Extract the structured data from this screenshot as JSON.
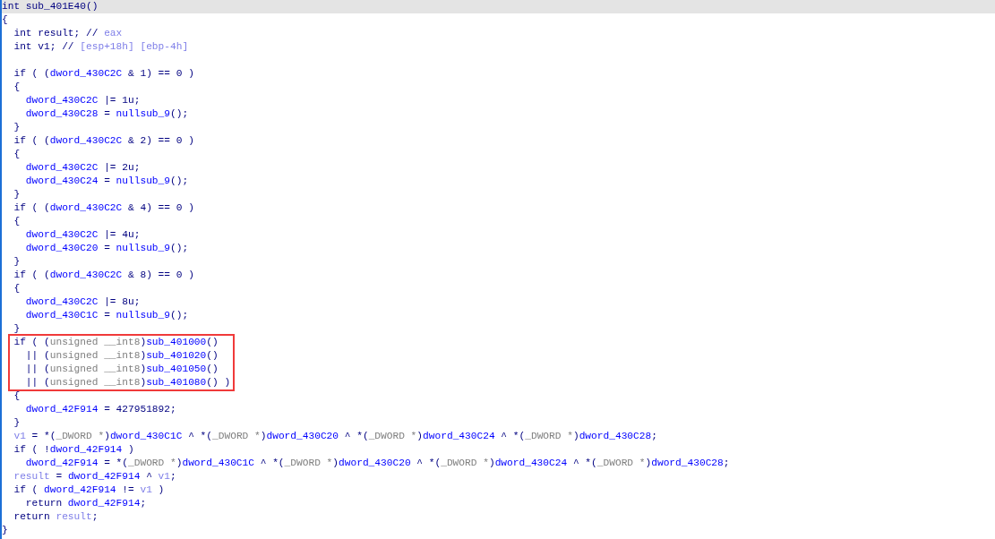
{
  "code_lines": [
    {
      "selected": true,
      "boxed": false,
      "tokens": [
        {
          "kind": "plain",
          "text": "int sub_401E40()"
        }
      ]
    },
    {
      "selected": false,
      "boxed": false,
      "tokens": [
        {
          "kind": "plain",
          "text": "{"
        }
      ]
    },
    {
      "selected": false,
      "boxed": false,
      "tokens": [
        {
          "kind": "plain",
          "text": "  int result; // "
        },
        {
          "kind": "local",
          "text": "eax"
        }
      ]
    },
    {
      "selected": false,
      "boxed": false,
      "tokens": [
        {
          "kind": "plain",
          "text": "  int v1; // "
        },
        {
          "kind": "local",
          "text": "[esp+18h] [ebp-4h]"
        }
      ]
    },
    {
      "selected": false,
      "boxed": false
    },
    {
      "selected": false,
      "boxed": false,
      "tokens": [
        {
          "kind": "plain",
          "text": "  if ( ("
        },
        {
          "kind": "global",
          "text": "dword_430C2C"
        },
        {
          "kind": "plain",
          "text": " & 1) == 0 )"
        }
      ]
    },
    {
      "selected": false,
      "boxed": false,
      "tokens": [
        {
          "kind": "plain",
          "text": "  {"
        }
      ]
    },
    {
      "selected": false,
      "boxed": false,
      "tokens": [
        {
          "kind": "global",
          "text": "    dword_430C2C"
        },
        {
          "kind": "plain",
          "text": " |= 1u;"
        }
      ]
    },
    {
      "selected": false,
      "boxed": false,
      "tokens": [
        {
          "kind": "global",
          "text": "    dword_430C28"
        },
        {
          "kind": "plain",
          "text": " = "
        },
        {
          "kind": "global",
          "text": "nullsub_9"
        },
        {
          "kind": "plain",
          "text": "();"
        }
      ]
    },
    {
      "selected": false,
      "boxed": false,
      "tokens": [
        {
          "kind": "plain",
          "text": "  }"
        }
      ]
    },
    {
      "selected": false,
      "boxed": false,
      "tokens": [
        {
          "kind": "plain",
          "text": "  if ( ("
        },
        {
          "kind": "global",
          "text": "dword_430C2C"
        },
        {
          "kind": "plain",
          "text": " & 2) == 0 )"
        }
      ]
    },
    {
      "selected": false,
      "boxed": false,
      "tokens": [
        {
          "kind": "plain",
          "text": "  {"
        }
      ]
    },
    {
      "selected": false,
      "boxed": false,
      "tokens": [
        {
          "kind": "global",
          "text": "    dword_430C2C"
        },
        {
          "kind": "plain",
          "text": " |= 2u;"
        }
      ]
    },
    {
      "selected": false,
      "boxed": false,
      "tokens": [
        {
          "kind": "global",
          "text": "    dword_430C24"
        },
        {
          "kind": "plain",
          "text": " = "
        },
        {
          "kind": "global",
          "text": "nullsub_9"
        },
        {
          "kind": "plain",
          "text": "();"
        }
      ]
    },
    {
      "selected": false,
      "boxed": false,
      "tokens": [
        {
          "kind": "plain",
          "text": "  }"
        }
      ]
    },
    {
      "selected": false,
      "boxed": false,
      "tokens": [
        {
          "kind": "plain",
          "text": "  if ( ("
        },
        {
          "kind": "global",
          "text": "dword_430C2C"
        },
        {
          "kind": "plain",
          "text": " & 4) == 0 )"
        }
      ]
    },
    {
      "selected": false,
      "boxed": false,
      "tokens": [
        {
          "kind": "plain",
          "text": "  {"
        }
      ]
    },
    {
      "selected": false,
      "boxed": false,
      "tokens": [
        {
          "kind": "global",
          "text": "    dword_430C2C"
        },
        {
          "kind": "plain",
          "text": " |= 4u;"
        }
      ]
    },
    {
      "selected": false,
      "boxed": false,
      "tokens": [
        {
          "kind": "global",
          "text": "    dword_430C20"
        },
        {
          "kind": "plain",
          "text": " = "
        },
        {
          "kind": "global",
          "text": "nullsub_9"
        },
        {
          "kind": "plain",
          "text": "();"
        }
      ]
    },
    {
      "selected": false,
      "boxed": false,
      "tokens": [
        {
          "kind": "plain",
          "text": "  }"
        }
      ]
    },
    {
      "selected": false,
      "boxed": false,
      "tokens": [
        {
          "kind": "plain",
          "text": "  if ( ("
        },
        {
          "kind": "global",
          "text": "dword_430C2C"
        },
        {
          "kind": "plain",
          "text": " & 8) == 0 )"
        }
      ]
    },
    {
      "selected": false,
      "boxed": false,
      "tokens": [
        {
          "kind": "plain",
          "text": "  {"
        }
      ]
    },
    {
      "selected": false,
      "boxed": false,
      "tokens": [
        {
          "kind": "global",
          "text": "    dword_430C2C"
        },
        {
          "kind": "plain",
          "text": " |= 8u;"
        }
      ]
    },
    {
      "selected": false,
      "boxed": false,
      "tokens": [
        {
          "kind": "global",
          "text": "    dword_430C1C"
        },
        {
          "kind": "plain",
          "text": " = "
        },
        {
          "kind": "global",
          "text": "nullsub_9"
        },
        {
          "kind": "plain",
          "text": "();"
        }
      ]
    },
    {
      "selected": false,
      "boxed": false,
      "tokens": [
        {
          "kind": "plain",
          "text": "  }"
        }
      ]
    },
    {
      "selected": false,
      "boxed": true,
      "tokens": [
        {
          "kind": "plain",
          "text": "  if ( ("
        },
        {
          "kind": "cast",
          "text": "unsigned __int8"
        },
        {
          "kind": "plain",
          "text": ")"
        },
        {
          "kind": "global",
          "text": "sub_401000"
        },
        {
          "kind": "plain",
          "text": "()"
        }
      ]
    },
    {
      "selected": false,
      "boxed": true,
      "tokens": [
        {
          "kind": "plain",
          "text": "    || ("
        },
        {
          "kind": "cast",
          "text": "unsigned __int8"
        },
        {
          "kind": "plain",
          "text": ")"
        },
        {
          "kind": "global",
          "text": "sub_401020"
        },
        {
          "kind": "plain",
          "text": "()"
        }
      ]
    },
    {
      "selected": false,
      "boxed": true,
      "tokens": [
        {
          "kind": "plain",
          "text": "    || ("
        },
        {
          "kind": "cast",
          "text": "unsigned __int8"
        },
        {
          "kind": "plain",
          "text": ")"
        },
        {
          "kind": "global",
          "text": "sub_401050"
        },
        {
          "kind": "plain",
          "text": "()"
        }
      ]
    },
    {
      "selected": false,
      "boxed": true,
      "tokens": [
        {
          "kind": "plain",
          "text": "    || ("
        },
        {
          "kind": "cast",
          "text": "unsigned __int8"
        },
        {
          "kind": "plain",
          "text": ")"
        },
        {
          "kind": "global",
          "text": "sub_401080"
        },
        {
          "kind": "plain",
          "text": "() )"
        }
      ]
    },
    {
      "selected": false,
      "boxed": false,
      "tokens": [
        {
          "kind": "plain",
          "text": "  {"
        }
      ]
    },
    {
      "selected": false,
      "boxed": false,
      "tokens": [
        {
          "kind": "global",
          "text": "    dword_42F914"
        },
        {
          "kind": "plain",
          "text": " = 427951892;"
        }
      ]
    },
    {
      "selected": false,
      "boxed": false,
      "tokens": [
        {
          "kind": "plain",
          "text": "  }"
        }
      ]
    },
    {
      "selected": false,
      "boxed": false,
      "tokens": [
        {
          "kind": "local",
          "text": "  v1"
        },
        {
          "kind": "plain",
          "text": " = *("
        },
        {
          "kind": "cast",
          "text": "_DWORD *"
        },
        {
          "kind": "plain",
          "text": ")"
        },
        {
          "kind": "global",
          "text": "dword_430C1C"
        },
        {
          "kind": "plain",
          "text": " ^ *("
        },
        {
          "kind": "cast",
          "text": "_DWORD *"
        },
        {
          "kind": "plain",
          "text": ")"
        },
        {
          "kind": "global",
          "text": "dword_430C20"
        },
        {
          "kind": "plain",
          "text": " ^ *("
        },
        {
          "kind": "cast",
          "text": "_DWORD *"
        },
        {
          "kind": "plain",
          "text": ")"
        },
        {
          "kind": "global",
          "text": "dword_430C24"
        },
        {
          "kind": "plain",
          "text": " ^ *("
        },
        {
          "kind": "cast",
          "text": "_DWORD *"
        },
        {
          "kind": "plain",
          "text": ")"
        },
        {
          "kind": "global",
          "text": "dword_430C28"
        },
        {
          "kind": "plain",
          "text": ";"
        }
      ]
    },
    {
      "selected": false,
      "boxed": false,
      "tokens": [
        {
          "kind": "plain",
          "text": "  if ( !"
        },
        {
          "kind": "global",
          "text": "dword_42F914"
        },
        {
          "kind": "plain",
          "text": " )"
        }
      ]
    },
    {
      "selected": false,
      "boxed": false,
      "tokens": [
        {
          "kind": "global",
          "text": "    dword_42F914"
        },
        {
          "kind": "plain",
          "text": " = *("
        },
        {
          "kind": "cast",
          "text": "_DWORD *"
        },
        {
          "kind": "plain",
          "text": ")"
        },
        {
          "kind": "global",
          "text": "dword_430C1C"
        },
        {
          "kind": "plain",
          "text": " ^ *("
        },
        {
          "kind": "cast",
          "text": "_DWORD *"
        },
        {
          "kind": "plain",
          "text": ")"
        },
        {
          "kind": "global",
          "text": "dword_430C20"
        },
        {
          "kind": "plain",
          "text": " ^ *("
        },
        {
          "kind": "cast",
          "text": "_DWORD *"
        },
        {
          "kind": "plain",
          "text": ")"
        },
        {
          "kind": "global",
          "text": "dword_430C24"
        },
        {
          "kind": "plain",
          "text": " ^ *("
        },
        {
          "kind": "cast",
          "text": "_DWORD *"
        },
        {
          "kind": "plain",
          "text": ")"
        },
        {
          "kind": "global",
          "text": "dword_430C28"
        },
        {
          "kind": "plain",
          "text": ";"
        }
      ]
    },
    {
      "selected": false,
      "boxed": false,
      "tokens": [
        {
          "kind": "local",
          "text": "  result"
        },
        {
          "kind": "plain",
          "text": " = "
        },
        {
          "kind": "global",
          "text": "dword_42F914"
        },
        {
          "kind": "plain",
          "text": " ^ "
        },
        {
          "kind": "local",
          "text": "v1"
        },
        {
          "kind": "plain",
          "text": ";"
        }
      ]
    },
    {
      "selected": false,
      "boxed": false,
      "tokens": [
        {
          "kind": "plain",
          "text": "  if ( "
        },
        {
          "kind": "global",
          "text": "dword_42F914"
        },
        {
          "kind": "plain",
          "text": " != "
        },
        {
          "kind": "local",
          "text": "v1"
        },
        {
          "kind": "plain",
          "text": " )"
        }
      ]
    },
    {
      "selected": false,
      "boxed": false,
      "tokens": [
        {
          "kind": "plain",
          "text": "    return "
        },
        {
          "kind": "global",
          "text": "dword_42F914"
        },
        {
          "kind": "plain",
          "text": ";"
        }
      ]
    },
    {
      "selected": false,
      "boxed": false,
      "tokens": [
        {
          "kind": "plain",
          "text": "  return "
        },
        {
          "kind": "local",
          "text": "result"
        },
        {
          "kind": "plain",
          "text": ";"
        }
      ]
    },
    {
      "selected": false,
      "boxed": false,
      "tokens": [
        {
          "kind": "plain",
          "text": "}"
        }
      ]
    }
  ]
}
